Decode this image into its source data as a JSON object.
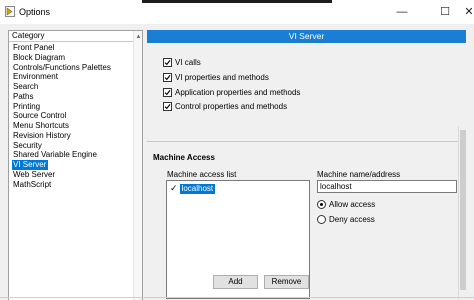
{
  "window": {
    "title": "Options",
    "controls": {
      "minimize": "—",
      "maximize": "☐",
      "close": "✕"
    }
  },
  "categories": {
    "header": "Category",
    "items": [
      "Front Panel",
      "Block Diagram",
      "Controls/Functions Palettes",
      "Environment",
      "Search",
      "Paths",
      "Printing",
      "Source Control",
      "Menu Shortcuts",
      "Revision History",
      "Security",
      "Shared Variable Engine",
      "VI Server",
      "Web Server",
      "MathScript"
    ],
    "selected": "VI Server"
  },
  "panel": {
    "header": "VI Server",
    "checkboxes": [
      {
        "label": "VI calls",
        "checked": true
      },
      {
        "label": "VI properties and methods",
        "checked": true
      },
      {
        "label": "Application properties and methods",
        "checked": true
      },
      {
        "label": "Control properties and methods",
        "checked": true
      }
    ],
    "machine_access": {
      "title": "Machine Access",
      "list_label": "Machine access list",
      "list_entries": [
        {
          "mark": "✓",
          "text": "localhost",
          "selected": true
        }
      ],
      "name_label": "Machine name/address",
      "name_value": "localhost",
      "radio_allow": "Allow access",
      "radio_deny": "Deny access",
      "allow_selected": true,
      "add_button": "Add",
      "remove_button": "Remove"
    }
  },
  "colors": {
    "accent": "#1a7fd4",
    "selection": "#0078d7"
  }
}
